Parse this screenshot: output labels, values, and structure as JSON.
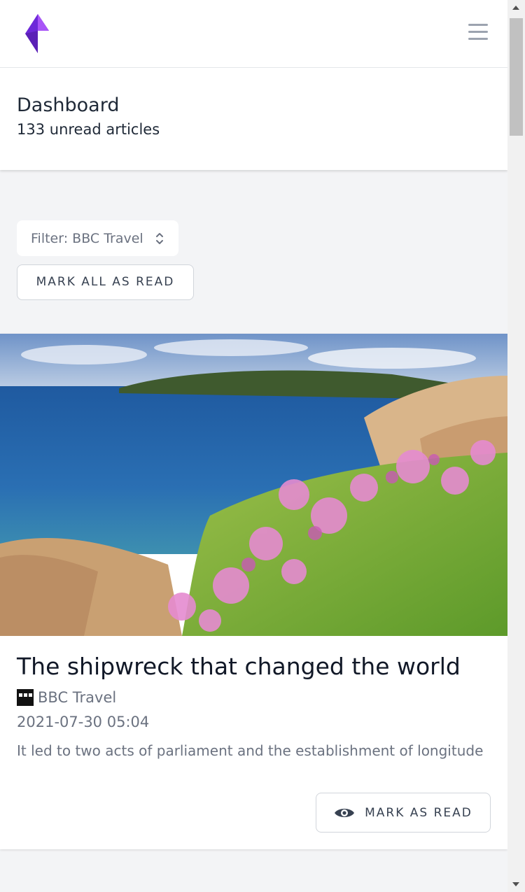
{
  "header": {
    "logo": "app-logo",
    "menu_icon": "hamburger-menu-icon"
  },
  "page": {
    "title": "Dashboard",
    "subtitle": "133 unread articles"
  },
  "controls": {
    "filter_label": "Filter: BBC Travel",
    "mark_all_label": "MARK ALL AS READ"
  },
  "article": {
    "image": "coastal-landscape-with-pink-flowers",
    "title": "The shipwreck that changed the world",
    "source_icon": "bbc-logo-icon",
    "source": "BBC Travel",
    "date": "2021-07-30 05:04",
    "description": "It led to two acts of parliament and the establishment of longitude",
    "mark_read_icon": "eye-icon",
    "mark_read_label": "MARK AS READ"
  },
  "colors": {
    "brand": "#7c3aed",
    "background": "#f3f4f6"
  }
}
